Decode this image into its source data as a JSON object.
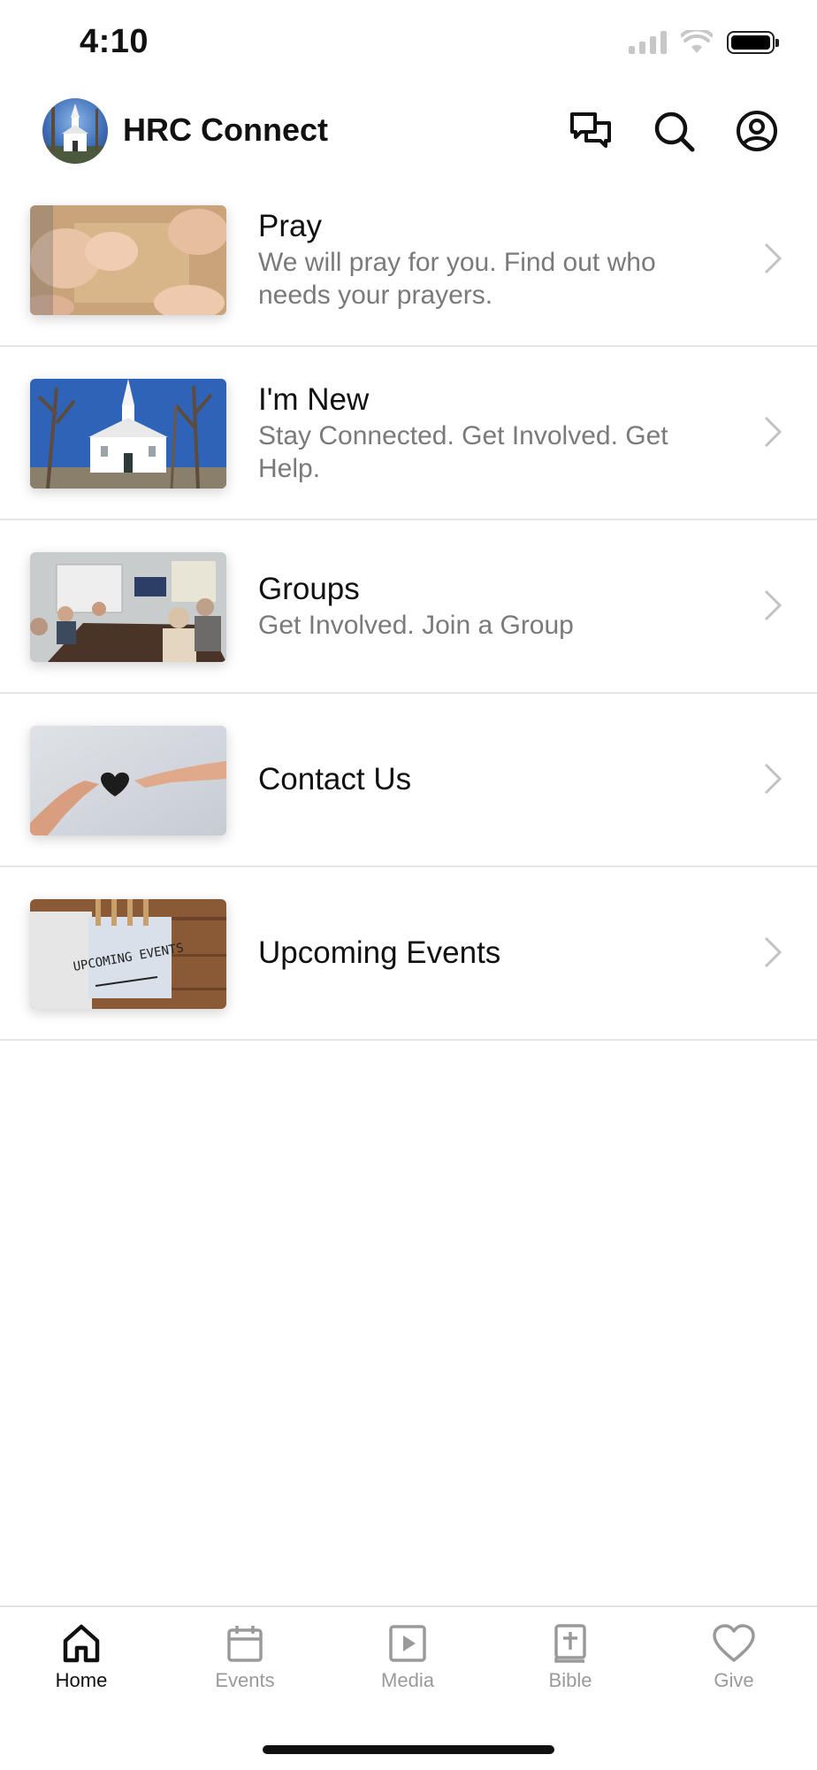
{
  "status_bar": {
    "time": "4:10"
  },
  "header": {
    "title": "HRC Connect",
    "icons": [
      "chat-icon",
      "search-icon",
      "profile-icon"
    ]
  },
  "items": [
    {
      "title": "Pray",
      "subtitle": "We will pray for you. Find out who needs your prayers."
    },
    {
      "title": "I'm New",
      "subtitle": "Stay Connected.  Get Involved.  Get Help."
    },
    {
      "title": "Groups",
      "subtitle": "Get Involved.  Join a Group"
    },
    {
      "title": "Contact Us",
      "subtitle": ""
    },
    {
      "title": "Upcoming Events",
      "subtitle": "",
      "thumb_text": "UPCOMING EVENTS"
    }
  ],
  "tabs": [
    {
      "label": "Home",
      "icon": "home-icon",
      "active": true
    },
    {
      "label": "Events",
      "icon": "calendar-icon",
      "active": false
    },
    {
      "label": "Media",
      "icon": "play-icon",
      "active": false
    },
    {
      "label": "Bible",
      "icon": "bible-icon",
      "active": false
    },
    {
      "label": "Give",
      "icon": "heart-icon",
      "active": false
    }
  ],
  "colors": {
    "tab_active": "#111111",
    "tab_inactive": "#9a9a9a",
    "subtitle": "#7a7a7a",
    "divider": "#e6e6e6"
  }
}
